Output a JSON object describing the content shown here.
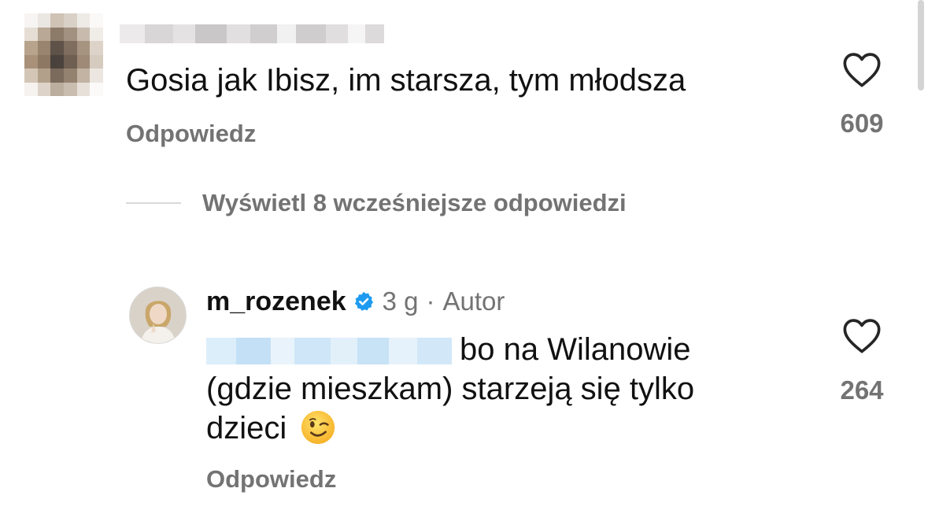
{
  "comment1": {
    "text": "Gosia jak Ibisz, im starsza, tym młodsza",
    "reply_label": "Odpowiedz",
    "likes": "609",
    "heart_icon": "heart-outline-icon"
  },
  "thread": {
    "view_replies_label": "Wyświetl 8 wcześniejsze odpowiedzi"
  },
  "comment2": {
    "username": "m_rozenek",
    "time": "3 g",
    "separator": "·",
    "role": "Autor",
    "text_line1": "bo na Wilanowie",
    "text_line2": "(gdzie mieszkam) starzeją się tylko",
    "text_line3": "dzieci",
    "emoji_icon": "winking-face-icon",
    "reply_label": "Odpowiedz",
    "likes": "264",
    "verified_icon": "verified-badge-icon",
    "heart_icon": "heart-outline-icon"
  },
  "colors": {
    "secondary_text": "#737373",
    "verified_blue": "#1d9bf0",
    "primary_text": "#111111"
  }
}
